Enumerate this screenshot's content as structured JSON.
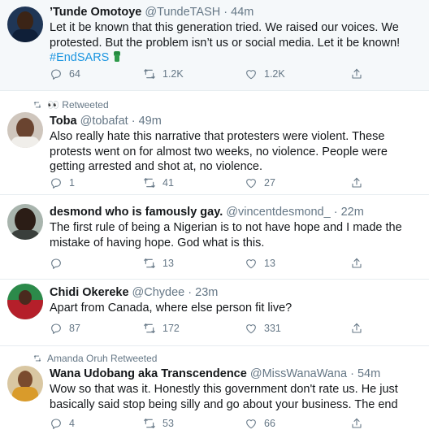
{
  "tweets": [
    {
      "name": "’Tunde Omotoye",
      "handle": "@TundeTASH",
      "sep": "·",
      "time": "44m",
      "text": "Let it be known that this generation tried. We raised our voices. We protested. But the problem isn’t us or social media. Let it be known!",
      "hashtag": "#EndSARS",
      "replies": "64",
      "retweets": "1.2K",
      "likes": "1.2K"
    },
    {
      "retweeted_by": "👀 Retweeted",
      "name": "Toba",
      "handle": "@tobafat",
      "sep": "·",
      "time": "49m",
      "text": "Also really hate this narrative that protesters were violent. These protests went on for almost two weeks, no violence. People were getting arrested and shot at, no violence.",
      "replies": "1",
      "retweets": "41",
      "likes": "27"
    },
    {
      "name": "desmond who is famously gay.",
      "handle": "@vincentdesmond_",
      "sep": "·",
      "time": "22m",
      "text": "The first rule of being a Nigerian is to not have hope and I made the mistake of having hope. God what is this.",
      "replies": "",
      "retweets": "13",
      "likes": "13"
    },
    {
      "name": "Chidi Okereke",
      "handle": "@Chydee",
      "sep": "·",
      "time": "23m",
      "text": "Apart from Canada, where else person fit live?",
      "replies": "87",
      "retweets": "172",
      "likes": "331"
    },
    {
      "retweeted_by": "Amanda Oruh Retweeted",
      "name": "Wana Udobang aka Transcendence",
      "handle": "@MissWanaWana",
      "sep": "·",
      "time": "54m",
      "text": "Wow so that was it. Honestly this government don't rate us. He just basically said stop being silly and go about your business. The end",
      "replies": "4",
      "retweets": "53",
      "likes": "66"
    }
  ],
  "icons": {
    "reply": "reply-icon",
    "retweet": "retweet-icon",
    "like": "heart-icon",
    "share": "share-icon"
  },
  "colors": {
    "link": "#1b95e0",
    "secondary": "#657786",
    "highlight_bg": "#f5f8fa"
  }
}
